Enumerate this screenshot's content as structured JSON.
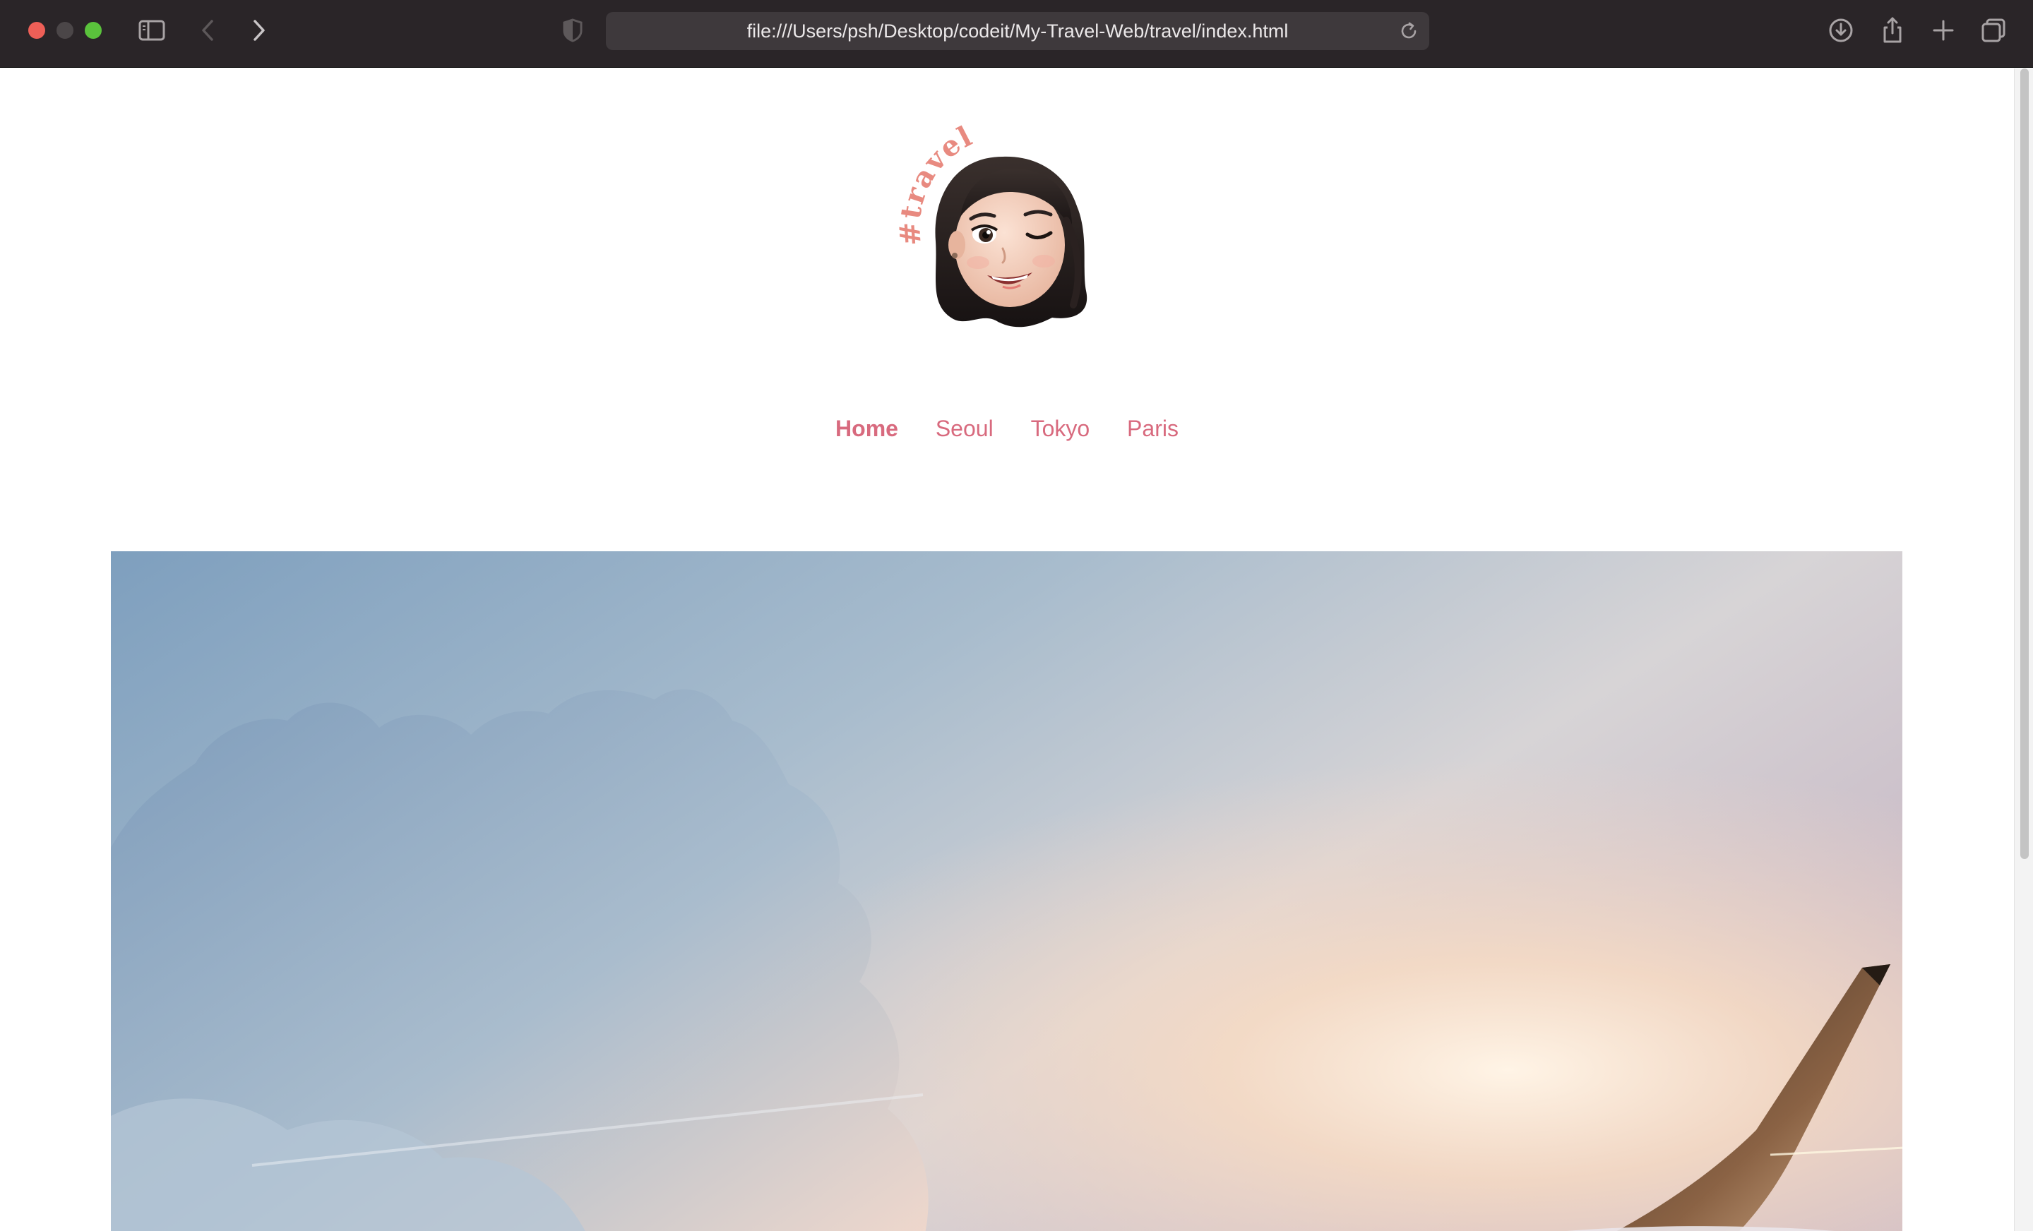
{
  "browser": {
    "url": "file:///Users/psh/Desktop/codeit/My-Travel-Web/travel/index.html",
    "icons": [
      "sidebar-icon",
      "back-icon",
      "forward-icon",
      "privacy-shield-icon",
      "reload-icon",
      "download-icon",
      "share-icon",
      "new-tab-icon",
      "tab-overview-icon"
    ]
  },
  "logo": {
    "sticker_text": "#travel",
    "accent_color": "#d86a7e"
  },
  "nav": {
    "items": [
      {
        "label": "Home"
      },
      {
        "label": "Seoul"
      },
      {
        "label": "Tokyo"
      },
      {
        "label": "Paris"
      }
    ],
    "color": "#d86a7e"
  },
  "hero": {
    "icon": "sky-with-airplane-wing-image"
  }
}
